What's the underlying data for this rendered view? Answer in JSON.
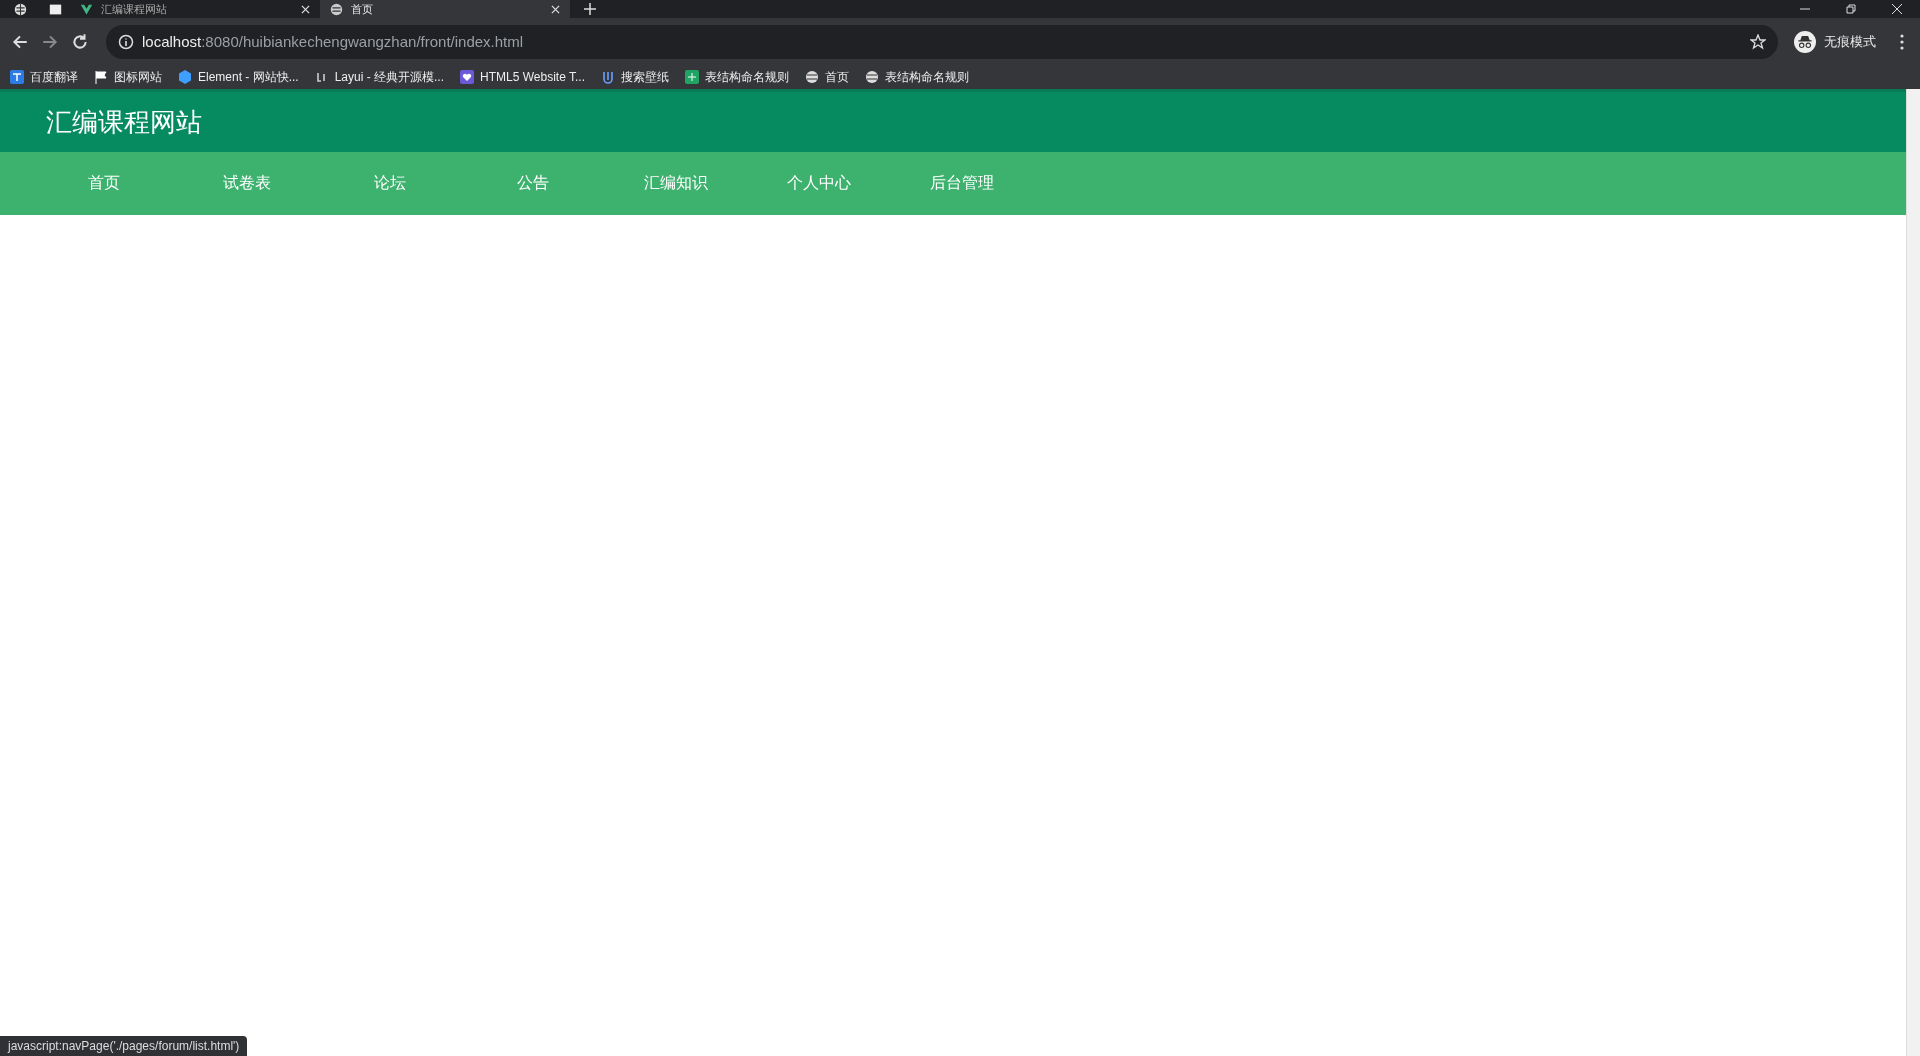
{
  "browser": {
    "tabs": [
      {
        "title": "汇编课程网站",
        "selected": false,
        "kind": "vue"
      },
      {
        "title": "首页",
        "selected": true,
        "kind": "globe"
      }
    ],
    "url_host": "localhost",
    "url_rest": ":8080/huibiankechengwangzhan/front/index.html",
    "profile": "无痕模式",
    "bookmarks": [
      {
        "label": "百度翻译",
        "kind": "translate"
      },
      {
        "label": "图标网站",
        "kind": "flag"
      },
      {
        "label": "Element - 网站快...",
        "kind": "hex"
      },
      {
        "label": "Layui - 经典开源模...",
        "kind": "layui"
      },
      {
        "label": "HTML5 Website T...",
        "kind": "html"
      },
      {
        "label": "搜索壁纸",
        "kind": "u"
      },
      {
        "label": "表结构命名规则",
        "kind": "sheet"
      },
      {
        "label": "首页",
        "kind": "globe"
      },
      {
        "label": "表结构命名规则",
        "kind": "globe"
      }
    ],
    "status": "javascript:navPage('./pages/forum/list.html')"
  },
  "site": {
    "title": "汇编课程网站",
    "nav": [
      {
        "label": "首页"
      },
      {
        "label": "试卷表"
      },
      {
        "label": "论坛"
      },
      {
        "label": "公告"
      },
      {
        "label": "汇编知识"
      },
      {
        "label": "个人中心"
      },
      {
        "label": "后台管理"
      }
    ]
  }
}
